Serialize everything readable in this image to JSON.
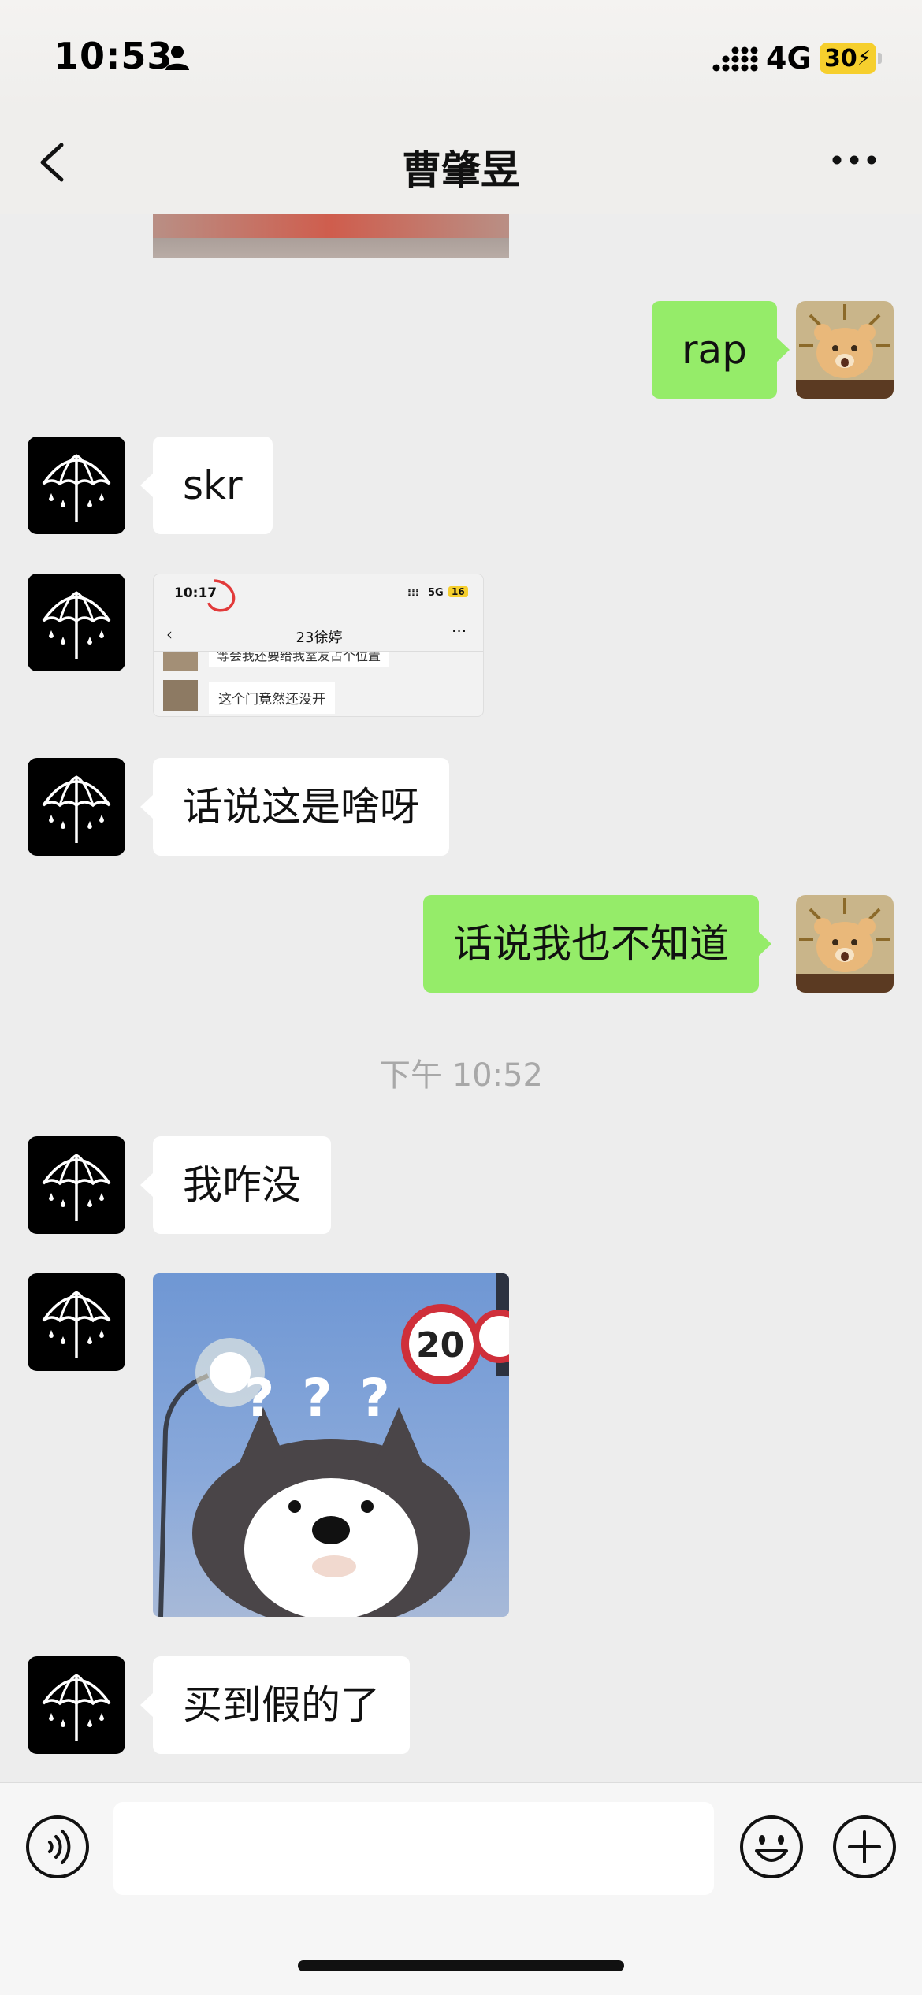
{
  "status_bar": {
    "time": "10:53",
    "network": "4G",
    "battery": "30"
  },
  "nav": {
    "title": "曹肇昱"
  },
  "messages": [
    {
      "side": "right",
      "type": "text",
      "text": "rap"
    },
    {
      "side": "left",
      "type": "text",
      "text": "skr"
    },
    {
      "side": "left",
      "type": "image",
      "description_kind": "screenshot",
      "screenshot": {
        "time": "10:17",
        "network": "5G",
        "battery": "16",
        "title": "23徐婷",
        "row1": "等会我还要给我室友占个位置",
        "row2": "这个门竟然还没开"
      }
    },
    {
      "side": "left",
      "type": "text",
      "text": "话说这是啥呀"
    },
    {
      "side": "right",
      "type": "text",
      "text": "话说我也不知道"
    },
    {
      "type": "time",
      "text": "下午 10:52"
    },
    {
      "side": "left",
      "type": "text",
      "text": "我咋没"
    },
    {
      "side": "left",
      "type": "image",
      "sticker": {
        "sign_number": "20",
        "marks": "? ? ?"
      }
    },
    {
      "side": "left",
      "type": "text",
      "text": "买到假的了"
    }
  ],
  "input": {
    "placeholder": ""
  },
  "colors": {
    "background": "#ededed",
    "bubble_self": "#95ec69",
    "bubble_other": "#ffffff",
    "battery": "#f6cf2d"
  },
  "icons": [
    "person-icon",
    "signal-icon",
    "back-icon",
    "more-icon",
    "umbrella-icon",
    "voice-icon",
    "emoji-icon",
    "plus-icon"
  ]
}
